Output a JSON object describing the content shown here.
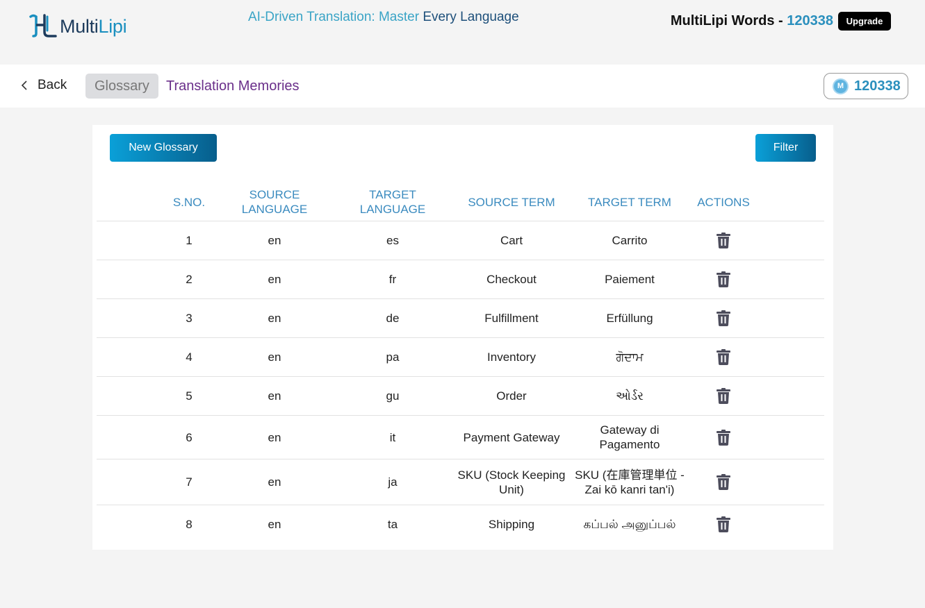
{
  "header": {
    "logo_text_main": "Multi",
    "logo_text_accent": "Lipi",
    "tagline_part1": "AI-Driven Translation: Master ",
    "tagline_part2": "Every Language",
    "words_label": "MultiLipi Words - ",
    "words_count": "120338",
    "upgrade_label": "Upgrade"
  },
  "nav": {
    "back_label": "Back",
    "tabs": [
      {
        "label": "Glossary",
        "active": true
      },
      {
        "label": "Translation Memories",
        "active": false
      }
    ],
    "credits_icon_letter": "M",
    "credits_value": "120338"
  },
  "toolbar": {
    "new_glossary_label": "New Glossary",
    "filter_label": "Filter"
  },
  "table": {
    "columns": [
      "S.NO.",
      "SOURCE LANGUAGE",
      "TARGET LANGUAGE",
      "SOURCE TERM",
      "TARGET TERM",
      "ACTIONS"
    ],
    "rows": [
      {
        "sno": "1",
        "source_language": "en",
        "target_language": "es",
        "source_term": "Cart",
        "target_term": "Carrito"
      },
      {
        "sno": "2",
        "source_language": "en",
        "target_language": "fr",
        "source_term": "Checkout",
        "target_term": "Paiement"
      },
      {
        "sno": "3",
        "source_language": "en",
        "target_language": "de",
        "source_term": "Fulfillment",
        "target_term": "Erfüllung"
      },
      {
        "sno": "4",
        "source_language": "en",
        "target_language": "pa",
        "source_term": "Inventory",
        "target_term": "ਗੋਦਾਮ"
      },
      {
        "sno": "5",
        "source_language": "en",
        "target_language": "gu",
        "source_term": "Order",
        "target_term": "ઓર્ડર"
      },
      {
        "sno": "6",
        "source_language": "en",
        "target_language": "it",
        "source_term": "Payment Gateway",
        "target_term": "Gateway di Pagamento"
      },
      {
        "sno": "7",
        "source_language": "en",
        "target_language": "ja",
        "source_term": "SKU (Stock Keeping Unit)",
        "target_term": "SKU (在庫管理単位 - Zai kō kanri tan'i)"
      },
      {
        "sno": "8",
        "source_language": "en",
        "target_language": "ta",
        "source_term": "Shipping",
        "target_term": "கப்பல் அனுப்பல்"
      }
    ]
  },
  "colors": {
    "accent": "#2a8fbd",
    "header_text": "#3b8bbf",
    "button_gradient_start": "#0aa0d8",
    "button_gradient_end": "#075e8c",
    "tm_tab": "#6a2f8a",
    "trash": "#4d4d5c"
  }
}
